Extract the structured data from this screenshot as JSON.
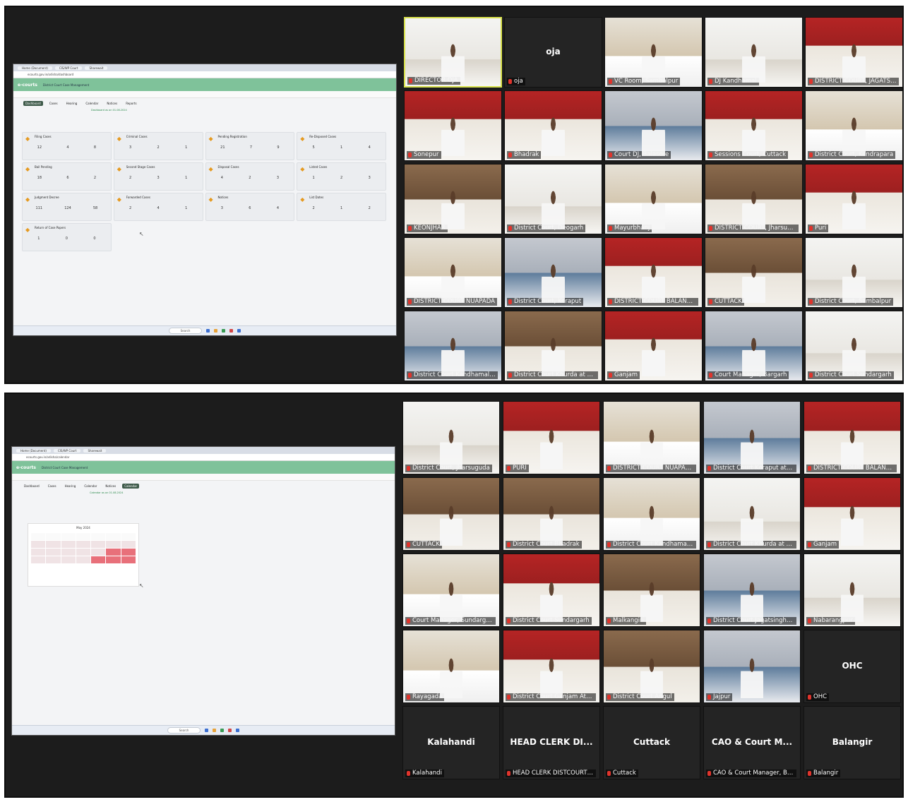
{
  "top_panel": {
    "shared_screen": {
      "browser_tabs": [
        "Home (Document)",
        "CIS/WP Court",
        "Sharewait"
      ],
      "url": "ecourts.gov.in/odisha/dashboard",
      "app_logo": "e-courts",
      "app_subtitle": "District Court Case Management",
      "caption": "Dashboard as on 01.08.2024",
      "nav_tabs": [
        "Dashboard",
        "Cases",
        "Hearing",
        "Calendar",
        "Notices",
        "Reports"
      ],
      "cards": [
        {
          "title": "Filing Cases",
          "nums": [
            "12",
            "4",
            "8"
          ]
        },
        {
          "title": "Criminal Cases",
          "nums": [
            "3",
            "2",
            "1"
          ]
        },
        {
          "title": "Pending Registration",
          "nums": [
            "21",
            "7",
            "9"
          ]
        },
        {
          "title": "Re-Disposed Cases",
          "nums": [
            "5",
            "1",
            "4"
          ]
        },
        {
          "title": "Bail Pending",
          "nums": [
            "18",
            "6",
            "2"
          ]
        },
        {
          "title": "Second Stage Cases",
          "nums": [
            "2",
            "3",
            "1"
          ]
        },
        {
          "title": "Disposal Cases",
          "nums": [
            "4",
            "2",
            "3"
          ]
        },
        {
          "title": "Listed Cases",
          "nums": [
            "1",
            "2",
            "3"
          ]
        },
        {
          "title": "Judgment Decree",
          "nums": [
            "111",
            "124",
            "58"
          ]
        },
        {
          "title": "Forwarded Cases",
          "nums": [
            "2",
            "4",
            "1"
          ]
        },
        {
          "title": "Notices",
          "nums": [
            "3",
            "6",
            "4"
          ]
        },
        {
          "title": "List Dates",
          "nums": [
            "2",
            "1",
            "2"
          ]
        },
        {
          "title": "Return of Case Papers",
          "nums": [
            "1",
            "0",
            "0"
          ]
        }
      ],
      "taskbar_search": "Search"
    },
    "tiles": [
      {
        "name": "DIRECTOR OJA",
        "variant": "v5",
        "active": true
      },
      {
        "name": "oja",
        "variant": "dark",
        "big": "oja"
      },
      {
        "name": "VC Room, Sambalpur",
        "variant": "v3"
      },
      {
        "name": "DJ Kandhamal",
        "variant": "v5"
      },
      {
        "name": "DISTRICT COURT, JAGATSINGHPUR",
        "variant": "v1"
      },
      {
        "name": "Sonepur",
        "variant": "v1"
      },
      {
        "name": "Bhadrak",
        "variant": "v1"
      },
      {
        "name": "Court DJ, Balasore",
        "variant": "v2"
      },
      {
        "name": "Sessions Court, Cuttack",
        "variant": "v1"
      },
      {
        "name": "District Court, Kendrapara",
        "variant": "v3"
      },
      {
        "name": "KEONJHAR",
        "variant": "v4"
      },
      {
        "name": "District Court, Deogarh",
        "variant": "v5"
      },
      {
        "name": "Mayurbhanj",
        "variant": "v3"
      },
      {
        "name": "DISTRICT COURT, Jharsuguda",
        "variant": "v4"
      },
      {
        "name": "Puri",
        "variant": "v1"
      },
      {
        "name": "DISTRICT COURT NUAPADA",
        "variant": "v3"
      },
      {
        "name": "District Court, Koraput",
        "variant": "v2"
      },
      {
        "name": "DISTRICT COURT BALANGIR",
        "variant": "v1"
      },
      {
        "name": "CUTTACK",
        "variant": "v4"
      },
      {
        "name": "District Court, Sambalpur",
        "variant": "v5"
      },
      {
        "name": "District Court Kandhamal Ph...",
        "variant": "v2"
      },
      {
        "name": "District Court Khurda at Bhubaneswar",
        "variant": "v4"
      },
      {
        "name": "Ganjam",
        "variant": "v1"
      },
      {
        "name": "Court Manager, Bargarh",
        "variant": "v2"
      },
      {
        "name": "District Court Sundargarh",
        "variant": "v5"
      }
    ]
  },
  "bottom_panel": {
    "shared_screen": {
      "browser_tabs": [
        "Home (Document)",
        "CIS/WP Court",
        "Sharewait"
      ],
      "url": "ecourts.gov.in/odisha/calendar",
      "app_logo": "e-courts",
      "app_subtitle": "District Court Case Management",
      "caption": "Calendar as on 01.08.2024",
      "nav_tabs": [
        "Dashboard",
        "Cases",
        "Hearing",
        "Calendar",
        "Notices",
        "Calendar"
      ],
      "calendar_title": "May 2024",
      "taskbar_search": "Search"
    },
    "tiles": [
      {
        "name": "District Court, Jharsuguda",
        "variant": "v5"
      },
      {
        "name": "PURI",
        "variant": "v1"
      },
      {
        "name": "DISTRICT COURT NUAPADA",
        "variant": "v3"
      },
      {
        "name": "District Court Koraput at Jeypore",
        "variant": "v2"
      },
      {
        "name": "DISTRICT COURT BALANGIR",
        "variant": "v1"
      },
      {
        "name": "CUTTACK",
        "variant": "v4"
      },
      {
        "name": "District Court Bhadrak",
        "variant": "v4"
      },
      {
        "name": "District Court Kandhamal Ph...",
        "variant": "v3"
      },
      {
        "name": "District Court Khurda at Bhubaneswar",
        "variant": "v5"
      },
      {
        "name": "Ganjam",
        "variant": "v1"
      },
      {
        "name": "Court Manager, Sundargarh",
        "variant": "v3"
      },
      {
        "name": "District Court Sundargarh",
        "variant": "v1"
      },
      {
        "name": "Malkangiri",
        "variant": "v4"
      },
      {
        "name": "District Court Jagatsinghpur",
        "variant": "v2"
      },
      {
        "name": "Nabarangpur",
        "variant": "v5"
      },
      {
        "name": "Rayagada",
        "variant": "v3"
      },
      {
        "name": "District Court Ganjam At Berhampur",
        "variant": "v1"
      },
      {
        "name": "District Court Angul",
        "variant": "v4"
      },
      {
        "name": "Jajpur",
        "variant": "v2"
      },
      {
        "name": "OHC",
        "variant": "dark",
        "big": "OHC"
      },
      {
        "name": "Kalahandi",
        "variant": "dark",
        "big": "Kalahandi"
      },
      {
        "name": "HEAD CLERK DISTCOURT, KAL...",
        "variant": "dark",
        "big": "HEAD CLERK DI..."
      },
      {
        "name": "Cuttack",
        "variant": "dark",
        "big": "Cuttack"
      },
      {
        "name": "CAO & Court Manager, Balas...",
        "variant": "dark",
        "big": "CAO & Court M..."
      },
      {
        "name": "Balangir",
        "variant": "dark",
        "big": "Balangir"
      }
    ]
  }
}
